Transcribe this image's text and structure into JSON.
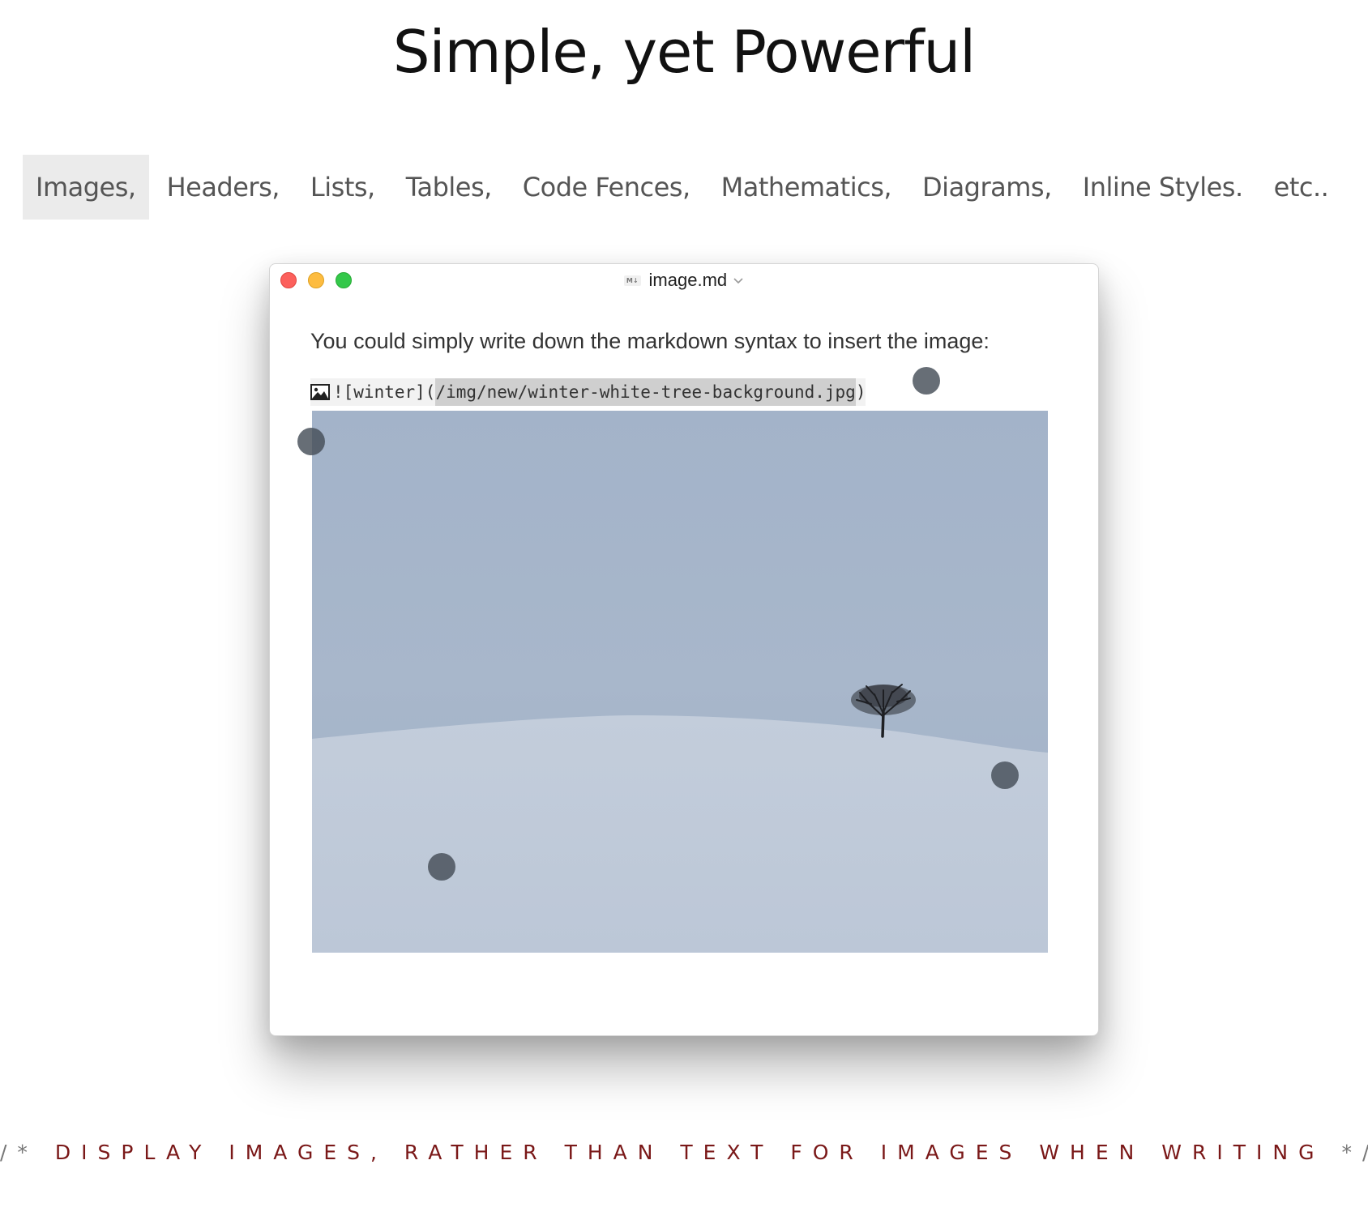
{
  "headline": "Simple, yet Powerful",
  "tabs": [
    {
      "label": "Images,",
      "active": true
    },
    {
      "label": "Headers,",
      "active": false
    },
    {
      "label": "Lists,",
      "active": false
    },
    {
      "label": "Tables,",
      "active": false
    },
    {
      "label": "Code Fences,",
      "active": false
    },
    {
      "label": "Mathematics,",
      "active": false
    },
    {
      "label": "Diagrams,",
      "active": false
    },
    {
      "label": "Inline Styles.",
      "active": false
    },
    {
      "label": "etc..",
      "active": false
    }
  ],
  "window": {
    "file_badge": "M↓",
    "title": "image.md",
    "paragraph": "You could simply write down the markdown syntax to insert the image:",
    "code": {
      "prefix": "![winter](",
      "path": "/img/new/winter-white-tree-background.jpg",
      "suffix": ")"
    }
  },
  "caption": {
    "open": "/*",
    "text": "DISPLAY IMAGES, RATHER THAN TEXT FOR IMAGES WHEN WRITING",
    "close": "*/"
  },
  "colors": {
    "active_tab_bg": "#ebebeb",
    "caption_red": "#7a1818",
    "sky": "#a4b4c9",
    "snow": "#bdc8d8"
  },
  "icons": [
    "md-file-icon",
    "chevron-down-icon",
    "image-icon"
  ]
}
